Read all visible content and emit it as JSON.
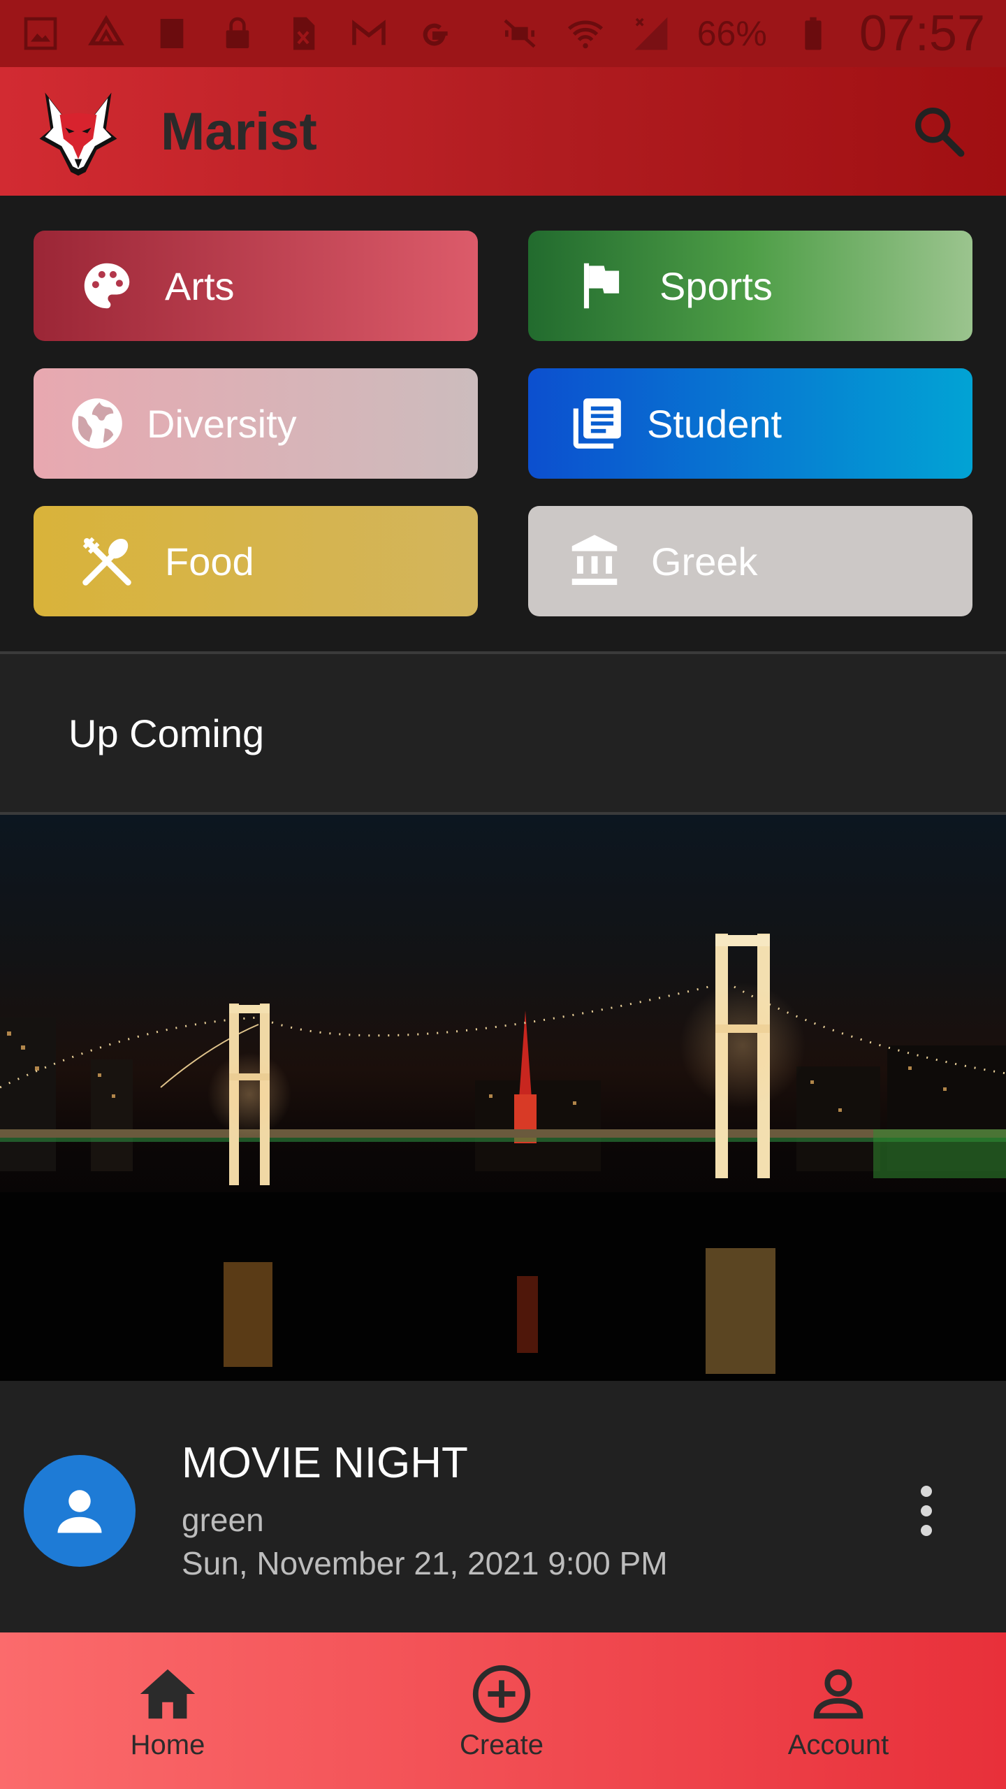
{
  "status_bar": {
    "battery": "66%",
    "time": "07:57"
  },
  "app_bar": {
    "title": "Marist"
  },
  "categories": [
    {
      "label": "Arts",
      "icon": "palette-icon"
    },
    {
      "label": "Sports",
      "icon": "flag-icon"
    },
    {
      "label": "Diversity",
      "icon": "globe-icon"
    },
    {
      "label": "Student",
      "icon": "library-books-icon"
    },
    {
      "label": "Food",
      "icon": "restaurant-icon"
    },
    {
      "label": "Greek",
      "icon": "institution-icon"
    }
  ],
  "upcoming": {
    "header": "Up Coming"
  },
  "event": {
    "title": "MOVIE NIGHT",
    "subtitle": "green",
    "date": "Sun, November 21, 2021 9:00 PM"
  },
  "bottom_nav": {
    "items": [
      {
        "label": "Home",
        "icon": "home-icon"
      },
      {
        "label": "Create",
        "icon": "add-circle-icon"
      },
      {
        "label": "Account",
        "icon": "person-icon"
      }
    ]
  },
  "colors": {
    "app_bar": "#b01c20",
    "accent_blue": "#1e7bd6",
    "bottom_nav": "#f0484f"
  }
}
